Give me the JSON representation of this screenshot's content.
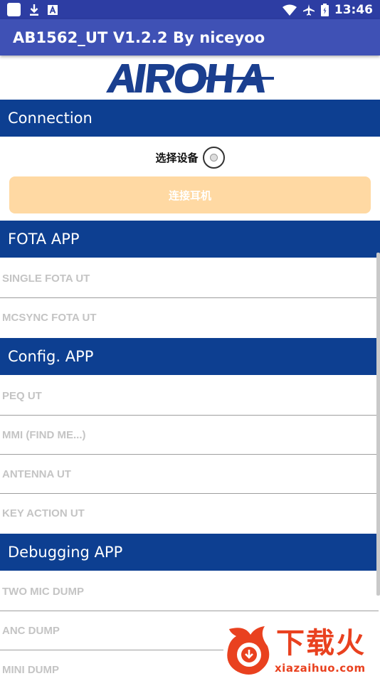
{
  "status_bar": {
    "time": "13:46",
    "left_icons": [
      "notification-square-icon",
      "download-icon",
      "a-badge-icon"
    ],
    "right_icons": [
      "wifi-icon",
      "airplane-icon",
      "battery-icon"
    ]
  },
  "app_bar": {
    "title": "AB1562_UT V1.2.2 By niceyoo"
  },
  "logo": {
    "text": "AIROHA",
    "color": "#1b3f8f"
  },
  "sections": {
    "connection": {
      "title": "Connection"
    },
    "fota": {
      "title": "FOTA APP",
      "items": [
        "SINGLE FOTA UT",
        "MCSYNC FOTA UT"
      ]
    },
    "config": {
      "title": "Config. APP",
      "items": [
        "PEQ UT",
        "MMI (FIND ME...)",
        "ANTENNA UT",
        "KEY ACTION UT"
      ]
    },
    "debugging": {
      "title": "Debugging APP",
      "items": [
        "TWO MIC DUMP",
        "ANC DUMP",
        "MINI DUMP"
      ]
    }
  },
  "connection": {
    "select_device_label": "选择设备",
    "connect_button_label": "连接耳机"
  },
  "watermark": {
    "brand": "下载火",
    "url": "xiazaihuo.com"
  },
  "colors": {
    "status_bar": "#2d3da3",
    "app_bar": "#3f51b5",
    "section_header": "#0d3f91",
    "connect_button": "#ffd9a3",
    "disabled_text": "#c4c4c4",
    "watermark_accent": "#e9411f"
  }
}
